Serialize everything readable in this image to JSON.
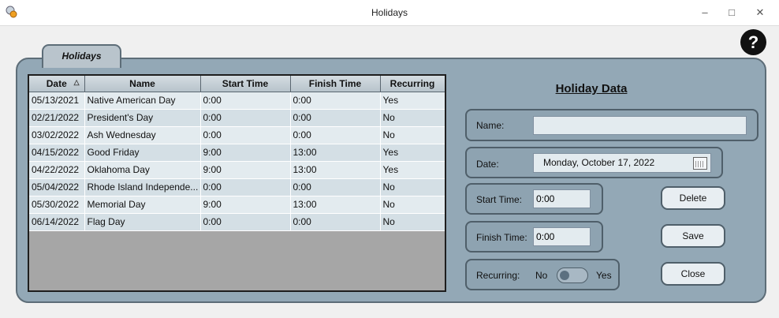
{
  "window": {
    "title": "Holidays"
  },
  "tab": {
    "label": "Holidays"
  },
  "grid": {
    "columns": [
      "Date",
      "Name",
      "Start Time",
      "Finish Time",
      "Recurring"
    ],
    "rows": [
      [
        "05/13/2021",
        "Native American Day",
        "0:00",
        "0:00",
        "Yes"
      ],
      [
        "02/21/2022",
        "President's Day",
        "0:00",
        "0:00",
        "No"
      ],
      [
        "03/02/2022",
        "Ash Wednesday",
        "0:00",
        "0:00",
        "No"
      ],
      [
        "04/15/2022",
        "Good Friday",
        "9:00",
        "13:00",
        "Yes"
      ],
      [
        "04/22/2022",
        "Oklahoma Day",
        "9:00",
        "13:00",
        "Yes"
      ],
      [
        "05/04/2022",
        "Rhode Island Independe...",
        "0:00",
        "0:00",
        "No"
      ],
      [
        "05/30/2022",
        "Memorial Day",
        "9:00",
        "13:00",
        "No"
      ],
      [
        "06/14/2022",
        "Flag Day",
        "0:00",
        "0:00",
        "No"
      ]
    ]
  },
  "form": {
    "heading": "Holiday Data",
    "name_label": "Name:",
    "name_value": "",
    "date_label": "Date:",
    "date_value": "Monday, October 17, 2022",
    "start_label": "Start Time:",
    "start_value": "0:00",
    "finish_label": "Finish Time:",
    "finish_value": "0:00",
    "recurring_label": "Recurring:",
    "recurring_no": "No",
    "recurring_yes": "Yes",
    "recurring_on": false
  },
  "buttons": {
    "delete": "Delete",
    "save": "Save",
    "close": "Close"
  },
  "help": {
    "label": "?"
  }
}
